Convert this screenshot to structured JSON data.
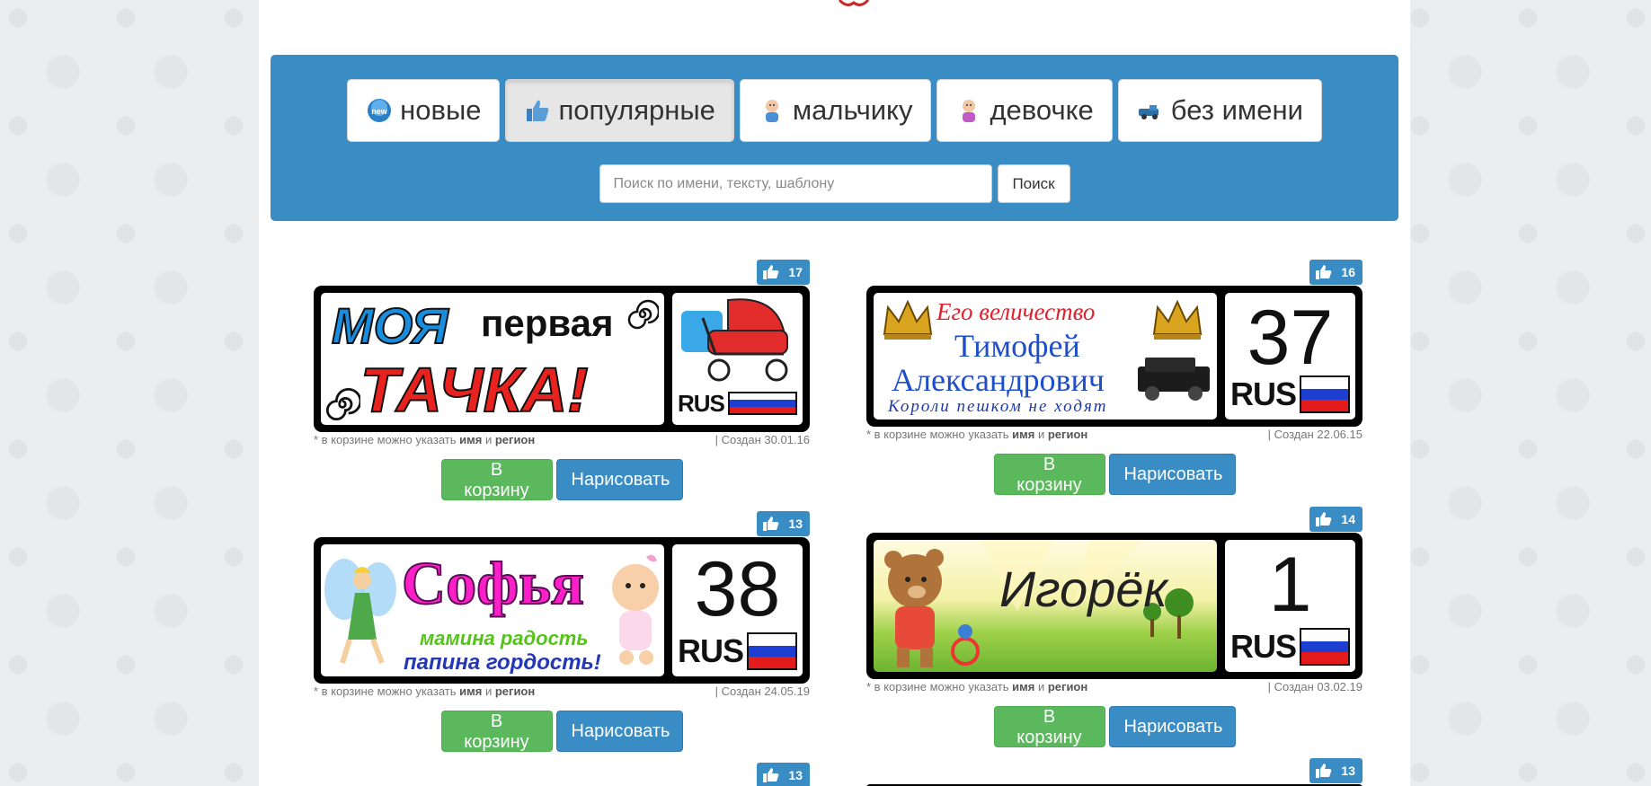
{
  "nav": {
    "categories": [
      {
        "label": "новые",
        "icon": "new-badge-icon",
        "active": false
      },
      {
        "label": "популярные",
        "icon": "thumbs-up-icon",
        "active": true
      },
      {
        "label": "мальчику",
        "icon": "baby-boy-icon",
        "active": false
      },
      {
        "label": "девочке",
        "icon": "baby-girl-icon",
        "active": false
      },
      {
        "label": "без имени",
        "icon": "toy-car-icon",
        "active": false
      }
    ],
    "search_placeholder": "Поиск по имени, тексту, шаблону",
    "search_button": "Поиск"
  },
  "common": {
    "note_prefix": "* в корзине можно указать",
    "note_name": "имя",
    "note_and": "и",
    "note_region": "регион",
    "cart_label": "В корзину",
    "draw_label": "Нарисовать",
    "rus": "RUS"
  },
  "cards": [
    {
      "likes": "17",
      "created": "| Создан 30.01.16",
      "text_lines": [
        "МОЯ",
        "первая",
        "ТАЧКА!"
      ],
      "region": ""
    },
    {
      "likes": "16",
      "created": "| Создан 22.06.15",
      "text_lines": [
        "Его величество",
        "Тимофей",
        "Александрович",
        "Короли пешком не ходят"
      ],
      "region": "37"
    },
    {
      "likes": "13",
      "created": "| Создан 24.05.19",
      "text_lines": [
        "Софья",
        "мамина радость",
        "папина гордость!"
      ],
      "region": "38"
    },
    {
      "likes": "14",
      "created": "| Создан 03.02.19",
      "text_lines": [
        "Игорёк"
      ],
      "region": "1"
    },
    {
      "likes": "13"
    },
    {
      "likes": "13"
    }
  ],
  "colors": {
    "nav_bg": "#3a8cc5",
    "cart_green": "#5cb85c",
    "draw_blue": "#3a8cc5"
  }
}
